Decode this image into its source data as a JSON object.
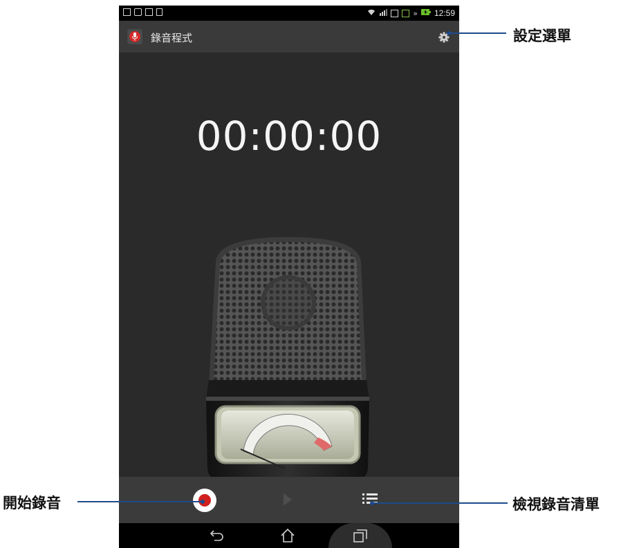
{
  "statusbar": {
    "time": "12:59"
  },
  "app": {
    "title": "錄音程式"
  },
  "timer": {
    "value": "00:00:00"
  },
  "callouts": {
    "settings": "設定選單",
    "start_recording": "開始錄音",
    "view_list": "檢視錄音清單"
  },
  "icons": {
    "app": "microphone-app-icon",
    "settings": "gear-icon",
    "record": "record-icon",
    "play": "play-icon",
    "list": "list-icon",
    "back": "back-icon",
    "home": "home-icon",
    "recents": "recent-apps-icon"
  },
  "colors": {
    "record_red": "#d01f1f",
    "callout_line": "#1e4b8c"
  }
}
